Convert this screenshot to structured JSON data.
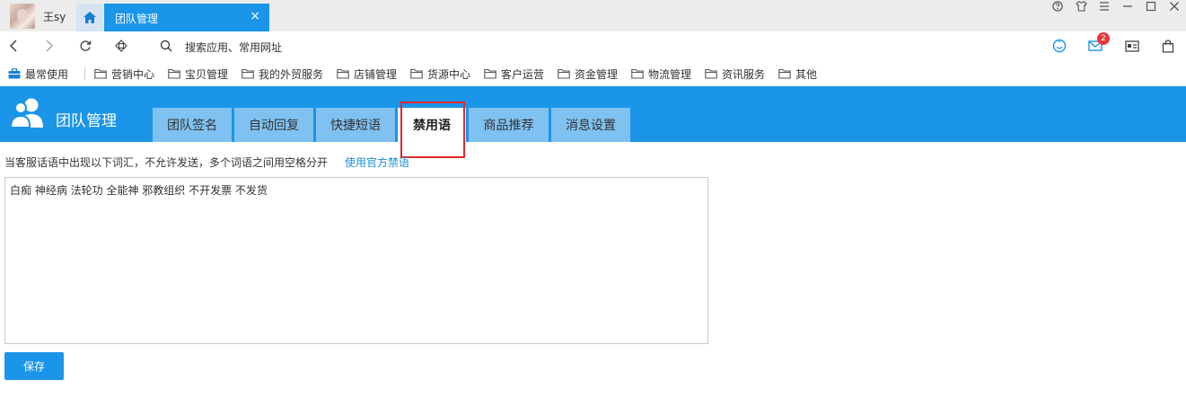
{
  "titlebar": {
    "username": "王sy",
    "active_tab_title": "团队管理",
    "close_glyph": "×"
  },
  "navbar": {
    "search_placeholder": "搜索应用、常用网址",
    "message_count": "2"
  },
  "bookmarks": [
    {
      "label": "最常使用",
      "icon": "briefcase-icon"
    },
    {
      "label": "营销中心",
      "icon": "folder-icon"
    },
    {
      "label": "宝贝管理",
      "icon": "folder-icon"
    },
    {
      "label": "我的外贸服务",
      "icon": "folder-icon"
    },
    {
      "label": "店铺管理",
      "icon": "folder-icon"
    },
    {
      "label": "货源中心",
      "icon": "folder-icon"
    },
    {
      "label": "客户运营",
      "icon": "folder-icon"
    },
    {
      "label": "资金管理",
      "icon": "folder-icon"
    },
    {
      "label": "物流管理",
      "icon": "folder-icon"
    },
    {
      "label": "资讯服务",
      "icon": "folder-icon"
    },
    {
      "label": "其他",
      "icon": "folder-icon"
    }
  ],
  "header": {
    "title": "团队管理",
    "tabs": [
      {
        "label": "团队签名",
        "active": false
      },
      {
        "label": "自动回复",
        "active": false
      },
      {
        "label": "快捷短语",
        "active": false
      },
      {
        "label": "禁用语",
        "active": true
      },
      {
        "label": "商品推荐",
        "active": false
      },
      {
        "label": "消息设置",
        "active": false
      }
    ]
  },
  "content": {
    "description": "当客服话语中出现以下词汇，不允许发送，多个词语之间用空格分开",
    "official_link": "使用官方禁语",
    "forbidden_words": "白痴 神经病 法轮功 全能神 邪教组织 不开发票 不发货",
    "save_label": "保存"
  },
  "colors": {
    "accent": "#1a95e8",
    "tab_inactive": "#7fc1f0",
    "highlight": "#e3262d",
    "link": "#1a8fd8",
    "badge": "#e5383b"
  }
}
